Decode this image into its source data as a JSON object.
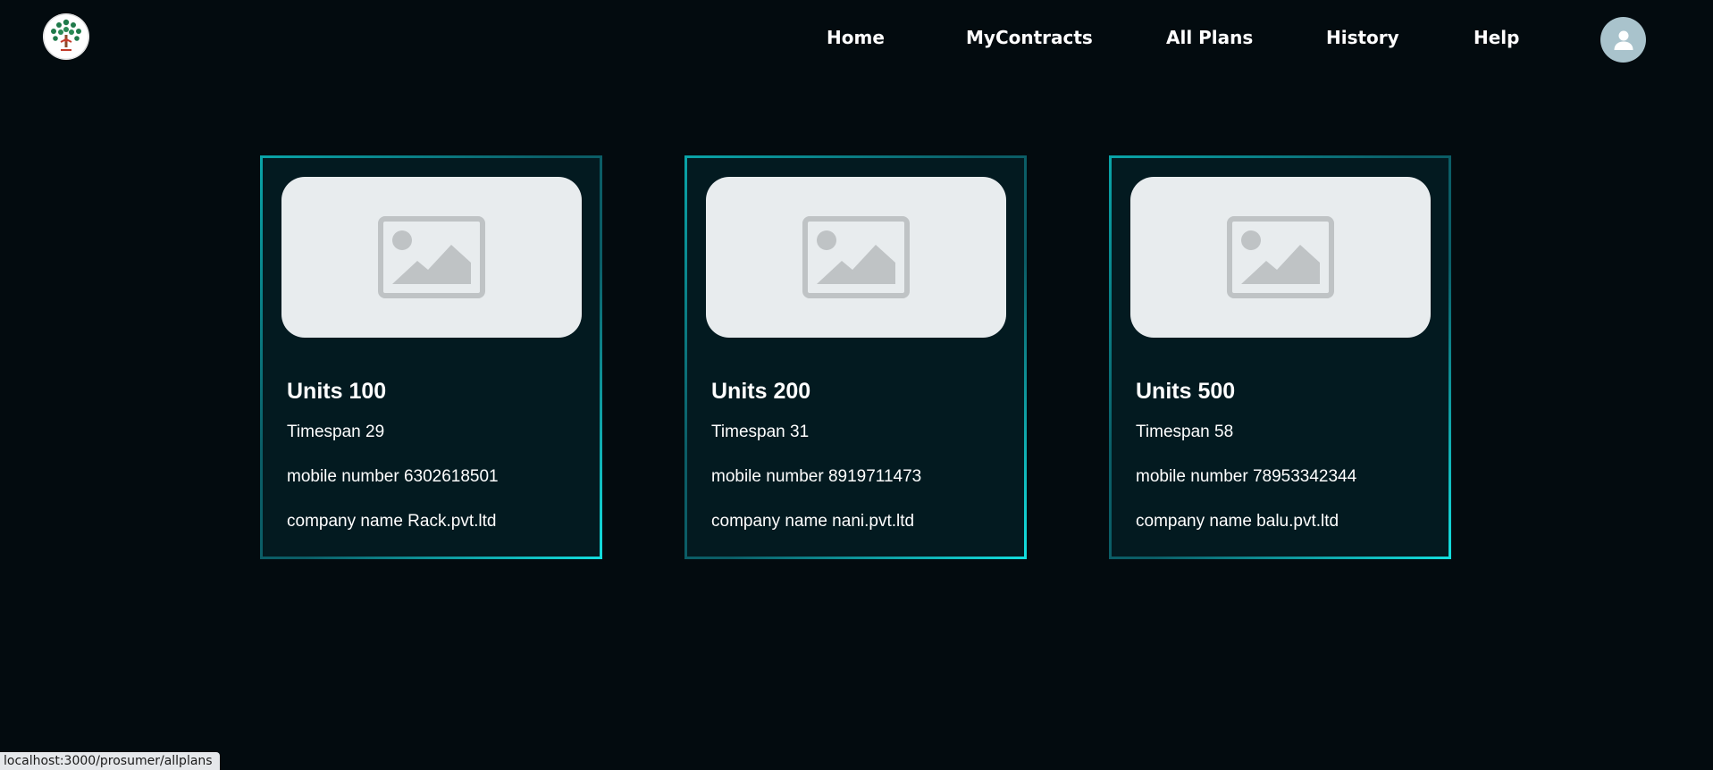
{
  "nav": {
    "items": [
      {
        "label": "Home"
      },
      {
        "label": "MyContracts"
      },
      {
        "label": "All Plans"
      },
      {
        "label": "History"
      },
      {
        "label": "Help"
      }
    ]
  },
  "plans": [
    {
      "units": "Units 100",
      "timespan": "Timespan 29",
      "mobile": "mobile number 6302618501",
      "company": "company name Rack.pvt.ltd"
    },
    {
      "units": "Units 200",
      "timespan": "Timespan 31",
      "mobile": "mobile number 8919711473",
      "company": "company name nani.pvt.ltd"
    },
    {
      "units": "Units 500",
      "timespan": "Timespan 58",
      "mobile": "mobile number 78953342344",
      "company": "company name balu.pvt.ltd"
    }
  ],
  "status_bar": {
    "url": "localhost:3000/prosumer/allplans"
  },
  "icons": {
    "logo": "tree-logo-icon",
    "avatar": "user-icon",
    "card_image": "image-placeholder-icon"
  },
  "colors": {
    "background": "#030b0f",
    "card_background": "#031a20",
    "card_border_glow": "#13dede",
    "avatar": "#a9c3cc",
    "placeholder": "#e8ecee"
  }
}
